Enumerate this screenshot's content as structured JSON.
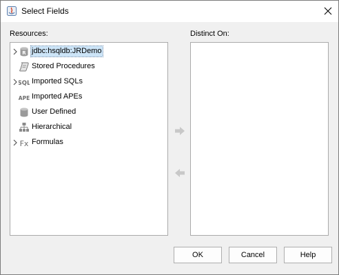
{
  "window": {
    "title": "Select Fields"
  },
  "resources": {
    "label": "Resources:",
    "items": [
      {
        "label": "jdbc:hsqldb:JRDemo",
        "icon": "database-icon",
        "expandable": true,
        "selected": true
      },
      {
        "label": "Stored Procedures",
        "icon": "scroll-icon",
        "expandable": false,
        "selected": false
      },
      {
        "label": "Imported SQLs",
        "icon": "sql-icon",
        "icon_text": "SQL",
        "expandable": true,
        "selected": false
      },
      {
        "label": "Imported APEs",
        "icon": "ape-icon",
        "icon_text": "APE",
        "expandable": false,
        "selected": false
      },
      {
        "label": "User Defined",
        "icon": "user-defined-db-icon",
        "expandable": false,
        "selected": false
      },
      {
        "label": "Hierarchical",
        "icon": "hierarchy-icon",
        "expandable": false,
        "selected": false
      },
      {
        "label": "Formulas",
        "icon": "formula-icon",
        "icon_text": "Fx",
        "expandable": true,
        "selected": false
      }
    ]
  },
  "distinct": {
    "label": "Distinct On:",
    "items": []
  },
  "buttons": {
    "ok": "OK",
    "cancel": "Cancel",
    "help": "Help"
  },
  "colors": {
    "selection": "#cce4f7",
    "icon_gray": "#8a8a8a",
    "disabled_arrow": "#c8c8c8"
  }
}
